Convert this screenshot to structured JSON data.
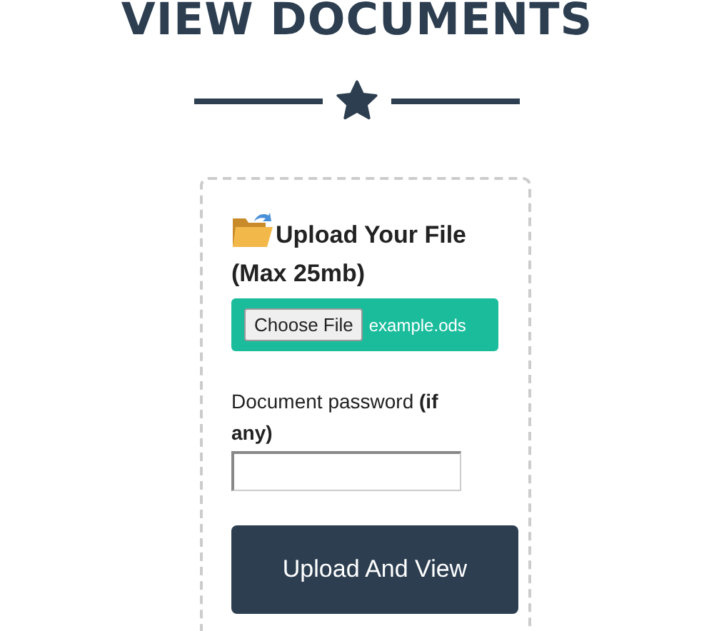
{
  "title": "VIEW DOCUMENTS",
  "upload": {
    "heading": "Upload Your File",
    "size_note": "(Max 25mb)",
    "choose_button": "Choose File",
    "file_name": "example.ods"
  },
  "password": {
    "label": "Document password **(if any)**"
  },
  "submit_button": "Upload And View"
}
